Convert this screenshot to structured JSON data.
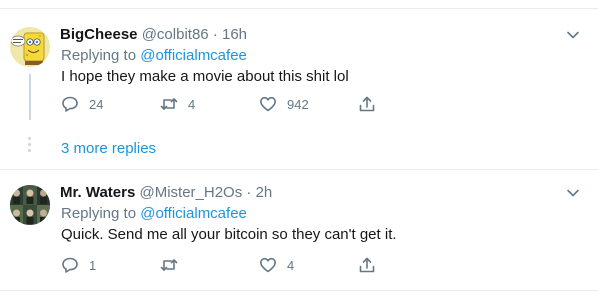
{
  "tweets": [
    {
      "name": "BigCheese",
      "handle": "@colbit86",
      "separator": "·",
      "time": "16h",
      "replying_prefix": "Replying to ",
      "replying_to": "@officialmcafee",
      "text": "I hope they make a movie about this shit lol",
      "replies": "24",
      "retweets": "4",
      "likes": "942",
      "avatar_icon": "spongebob-avatar-icon"
    },
    {
      "name": "Mr. Waters",
      "handle": "@Mister_H2Os",
      "separator": "·",
      "time": "2h",
      "replying_prefix": "Replying to ",
      "replying_to": "@officialmcafee",
      "text": "Quick. Send me all your bitcoin so they can't get it.",
      "replies": "1",
      "retweets": "",
      "likes": "4",
      "avatar_icon": "grid-portrait-avatar-icon"
    }
  ],
  "more_replies": "3 more replies",
  "colors": {
    "link": "#1b95e0",
    "muted": "#657786",
    "divider": "#e6ecf0",
    "text": "#14171a"
  }
}
